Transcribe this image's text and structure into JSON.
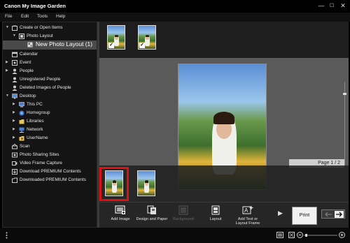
{
  "window": {
    "title": "Canon My Image Garden",
    "minimize": "—",
    "maximize": "☐",
    "close": "✕"
  },
  "menu": [
    "File",
    "Edit",
    "Tools",
    "Help"
  ],
  "sidebar": {
    "items": [
      {
        "label": "Create or Open Items",
        "icon": "create-items-icon",
        "arrow": "▼"
      },
      {
        "label": "Photo Layout",
        "icon": "photo-layout-icon",
        "arrow": "▼"
      },
      {
        "label": "New Photo Layout (1)",
        "icon": "layout-document-icon",
        "arrow": ""
      },
      {
        "label": "Calendar",
        "icon": "calendar-icon",
        "arrow": ""
      },
      {
        "label": "Event",
        "icon": "event-icon",
        "arrow": "▶"
      },
      {
        "label": "People",
        "icon": "people-icon",
        "arrow": "▶"
      },
      {
        "label": "Unregistered People",
        "icon": "person-unknown-icon",
        "arrow": ""
      },
      {
        "label": "Deleted Images of People",
        "icon": "person-deleted-icon",
        "arrow": ""
      },
      {
        "label": "Desktop",
        "icon": "desktop-folder-icon",
        "arrow": "▼"
      },
      {
        "label": "This PC",
        "icon": "computer-icon",
        "arrow": "▶"
      },
      {
        "label": "Homegroup",
        "icon": "homegroup-icon",
        "arrow": "▶"
      },
      {
        "label": "Libraries",
        "icon": "libraries-folder-icon",
        "arrow": "▶"
      },
      {
        "label": "Network",
        "icon": "network-icon",
        "arrow": "▶"
      },
      {
        "label": "UserName",
        "icon": "user-folder-icon",
        "arrow": "▶"
      },
      {
        "label": "Scan",
        "icon": "scan-icon",
        "arrow": ""
      },
      {
        "label": "Photo Sharing Sites",
        "icon": "photo-sharing-icon",
        "arrow": ""
      },
      {
        "label": "Video Frame Capture",
        "icon": "video-capture-icon",
        "arrow": ""
      },
      {
        "label": "Download PREMIUM Contents",
        "icon": "download-premium-icon",
        "arrow": ""
      },
      {
        "label": "Downloaded PREMIUM Contents",
        "icon": "downloaded-premium-icon",
        "arrow": ""
      }
    ]
  },
  "page": {
    "indicator": "Page 1 / 2"
  },
  "toolbar": {
    "add_image": "Add Image",
    "design_paper": "Design and Paper",
    "background": "Background",
    "layout": "Layout",
    "add_text": "Add Text or Layout Frame",
    "print": "Print",
    "next_arrow": "▶"
  },
  "colors": {
    "background": "#000000",
    "page_area": "#5a5a5a",
    "selection_red": "#e01010",
    "sidebar_selected": "#4a4a4a"
  }
}
